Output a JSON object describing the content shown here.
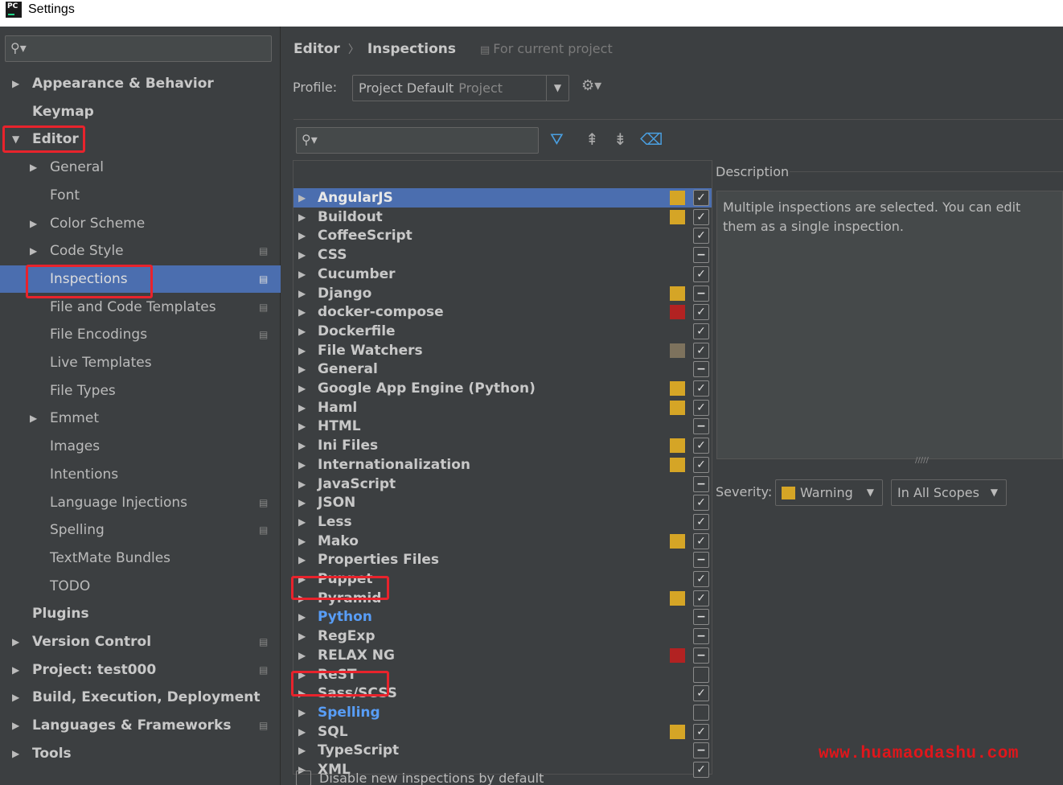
{
  "window": {
    "title": "Settings",
    "logo_text": "PC"
  },
  "sidebar": {
    "search_placeholder": "",
    "items": [
      {
        "label": "Appearance & Behavior",
        "arrow": "▶"
      },
      {
        "label": "Keymap",
        "arrow": ""
      },
      {
        "label": "Editor",
        "arrow": "▼"
      },
      {
        "label": "General",
        "arrow": "▶"
      },
      {
        "label": "Font",
        "arrow": ""
      },
      {
        "label": "Color Scheme",
        "arrow": "▶"
      },
      {
        "label": "Code Style",
        "arrow": "▶"
      },
      {
        "label": "Inspections",
        "arrow": ""
      },
      {
        "label": "File and Code Templates",
        "arrow": ""
      },
      {
        "label": "File Encodings",
        "arrow": ""
      },
      {
        "label": "Live Templates",
        "arrow": ""
      },
      {
        "label": "File Types",
        "arrow": ""
      },
      {
        "label": "Emmet",
        "arrow": "▶"
      },
      {
        "label": "Images",
        "arrow": ""
      },
      {
        "label": "Intentions",
        "arrow": ""
      },
      {
        "label": "Language Injections",
        "arrow": ""
      },
      {
        "label": "Spelling",
        "arrow": ""
      },
      {
        "label": "TextMate Bundles",
        "arrow": ""
      },
      {
        "label": "TODO",
        "arrow": ""
      },
      {
        "label": "Plugins",
        "arrow": ""
      },
      {
        "label": "Version Control",
        "arrow": "▶"
      },
      {
        "label": "Project: test000",
        "arrow": "▶"
      },
      {
        "label": "Build, Execution, Deployment",
        "arrow": "▶"
      },
      {
        "label": "Languages & Frameworks",
        "arrow": "▶"
      },
      {
        "label": "Tools",
        "arrow": "▶"
      }
    ]
  },
  "breadcrumb": {
    "part1": "Editor",
    "separator": "〉",
    "part2": "Inspections",
    "scope": "For current project"
  },
  "profile": {
    "label": "Profile:",
    "value": "Project Default",
    "tag": "Project"
  },
  "inspections": [
    {
      "label": "AngularJS",
      "severity": "#d5a526",
      "check": "✓"
    },
    {
      "label": "Buildout",
      "severity": "#d5a526",
      "check": "✓"
    },
    {
      "label": "CoffeeScript",
      "severity": "",
      "check": "✓"
    },
    {
      "label": "CSS",
      "severity": "",
      "check": "−"
    },
    {
      "label": "Cucumber",
      "severity": "",
      "check": "✓"
    },
    {
      "label": "Django",
      "severity": "#d5a526",
      "check": "−"
    },
    {
      "label": "docker-compose",
      "severity": "#b22222",
      "check": "✓"
    },
    {
      "label": "Dockerfile",
      "severity": "",
      "check": "✓"
    },
    {
      "label": "File Watchers",
      "severity": "#7d725d",
      "check": "✓"
    },
    {
      "label": "General",
      "severity": "",
      "check": "−"
    },
    {
      "label": "Google App Engine (Python)",
      "severity": "#d5a526",
      "check": "✓"
    },
    {
      "label": "Haml",
      "severity": "#d5a526",
      "check": "✓"
    },
    {
      "label": "HTML",
      "severity": "",
      "check": "−"
    },
    {
      "label": "Ini Files",
      "severity": "#d5a526",
      "check": "✓"
    },
    {
      "label": "Internationalization",
      "severity": "#d5a526",
      "check": "✓"
    },
    {
      "label": "JavaScript",
      "severity": "",
      "check": "−"
    },
    {
      "label": "JSON",
      "severity": "",
      "check": "✓"
    },
    {
      "label": "Less",
      "severity": "",
      "check": "✓"
    },
    {
      "label": "Mako",
      "severity": "#d5a526",
      "check": "✓"
    },
    {
      "label": "Properties Files",
      "severity": "",
      "check": "−"
    },
    {
      "label": "Puppet",
      "severity": "",
      "check": "✓"
    },
    {
      "label": "Pyramid",
      "severity": "#d5a526",
      "check": "✓"
    },
    {
      "label": "Python",
      "severity": "",
      "check": "−"
    },
    {
      "label": "RegExp",
      "severity": "",
      "check": "−"
    },
    {
      "label": "RELAX NG",
      "severity": "#b22222",
      "check": "−"
    },
    {
      "label": "ReST",
      "severity": "",
      "check": ""
    },
    {
      "label": "Sass/SCSS",
      "severity": "",
      "check": "✓"
    },
    {
      "label": "Spelling",
      "severity": "",
      "check": ""
    },
    {
      "label": "SQL",
      "severity": "#d5a526",
      "check": "✓"
    },
    {
      "label": "TypeScript",
      "severity": "",
      "check": "−"
    },
    {
      "label": "XML",
      "severity": "",
      "check": "✓"
    }
  ],
  "description": {
    "label": "Description",
    "text": "Multiple inspections are selected. You can edit them as a single inspection."
  },
  "severity": {
    "label": "Severity:",
    "value": "Warning",
    "color": "#d5a526"
  },
  "scope": {
    "value": "In All Scopes"
  },
  "bottom": {
    "disable_label": "Disable new inspections by default"
  },
  "watermark": "www.huamaodashu.com",
  "colors": {
    "selection": "#4b6eaf",
    "highlight_box": "#e8232c",
    "link_blue": "#589df6"
  }
}
